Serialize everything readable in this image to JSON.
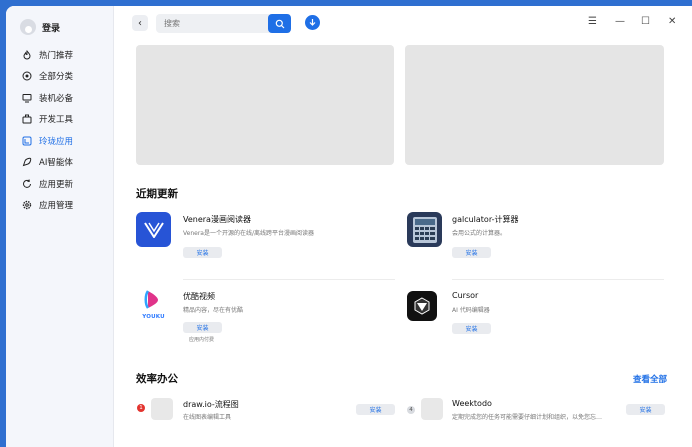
{
  "sidebar": {
    "account_label": "登录",
    "items": [
      {
        "label": "热门推荐",
        "icon": "flame-icon"
      },
      {
        "label": "全部分类",
        "icon": "grid-icon"
      },
      {
        "label": "装机必备",
        "icon": "monitor-icon"
      },
      {
        "label": "开发工具",
        "icon": "toolbox-icon"
      },
      {
        "label": "玲珑应用",
        "icon": "linglong-icon",
        "active": true
      },
      {
        "label": "AI智能体",
        "icon": "ai-icon"
      },
      {
        "label": "应用更新",
        "icon": "refresh-icon"
      },
      {
        "label": "应用管理",
        "icon": "settings-icon"
      }
    ]
  },
  "topbar": {
    "search_placeholder": "搜索",
    "menu_glyph": "☰",
    "minimize_glyph": "—",
    "maximize_glyph": "☐",
    "close_glyph": "✕"
  },
  "recent_updates": {
    "title": "近期更新",
    "apps": [
      {
        "name": "Venera漫画阅读器",
        "desc": "Venera是一个开源的在线/离线跨平台漫画阅读器",
        "button": "安装",
        "icon": "venera-icon"
      },
      {
        "name": "galculator-计算器",
        "desc": "会用公式的计算器。",
        "button": "安装",
        "icon": "calculator-icon"
      },
      {
        "name": "优酷视频",
        "desc": "精品内容，尽在有优酷",
        "button": "安装",
        "note": "应用内付费",
        "icon": "youku-icon",
        "icon_text": "YOUKU"
      },
      {
        "name": "Cursor",
        "desc": "AI 代码编辑器",
        "button": "安装",
        "icon": "cursor-icon"
      }
    ]
  },
  "productivity": {
    "title": "效率办公",
    "see_all": "查看全部",
    "apps": [
      {
        "name": "draw.io-流程图",
        "desc": "在线图表编辑工具",
        "button": "安装",
        "rank": "1"
      },
      {
        "name": "Weektodo",
        "desc": "定期完成您的任务可能需要仔细计划和组织，以免您忘…",
        "button": "安装",
        "rank": "4"
      }
    ]
  },
  "colors": {
    "accent": "#1f6fe6",
    "banner": "#e5e5e5",
    "window_bg": "#2f6fd0"
  }
}
